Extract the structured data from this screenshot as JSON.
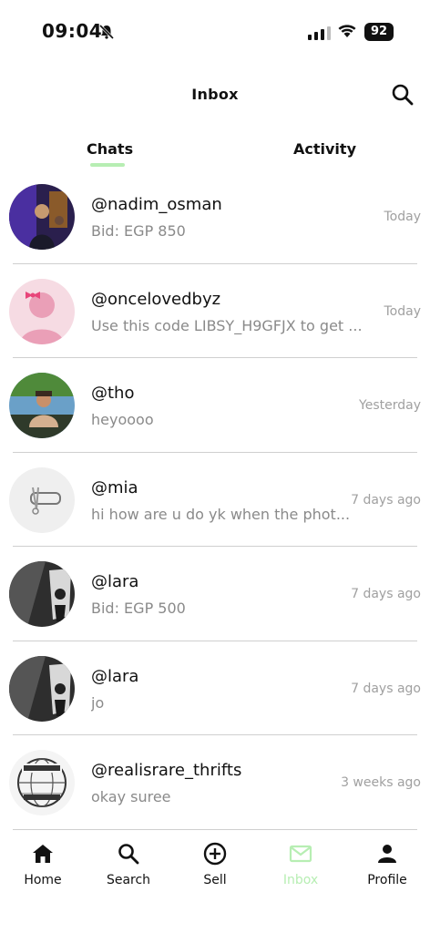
{
  "status_bar": {
    "time": "09:04",
    "battery": "92"
  },
  "header": {
    "title": "Inbox"
  },
  "tabs": [
    {
      "label": "Chats",
      "active": true
    },
    {
      "label": "Activity",
      "active": false
    }
  ],
  "chats": [
    {
      "username": "@nadim_osman",
      "preview": "Bid: EGP 850",
      "time": "Today"
    },
    {
      "username": "@oncelovedbyz",
      "preview": "Use this code LIBSY_H9GFJX to get ...",
      "time": "Today"
    },
    {
      "username": "@tho",
      "preview": "heyoooo",
      "time": "Yesterday"
    },
    {
      "username": "@mia",
      "preview": "hi how are u do yk when the phot...",
      "time": "7 days ago"
    },
    {
      "username": "@lara",
      "preview": "Bid: EGP 500",
      "time": "7 days ago"
    },
    {
      "username": "@lara",
      "preview": "jo",
      "time": "7 days ago"
    },
    {
      "username": "@realisrare_thrifts",
      "preview": "okay suree",
      "time": "3 weeks ago"
    }
  ],
  "bottom_nav": [
    {
      "label": "Home",
      "icon": "home-icon"
    },
    {
      "label": "Search",
      "icon": "search-icon"
    },
    {
      "label": "Sell",
      "icon": "plus-circle-icon"
    },
    {
      "label": "Inbox",
      "icon": "mail-icon",
      "active": true
    },
    {
      "label": "Profile",
      "icon": "person-icon"
    }
  ],
  "colors": {
    "accent": "#b7eeb3",
    "divider": "#cfcfcf",
    "secondary_text": "#8a8a8a"
  }
}
